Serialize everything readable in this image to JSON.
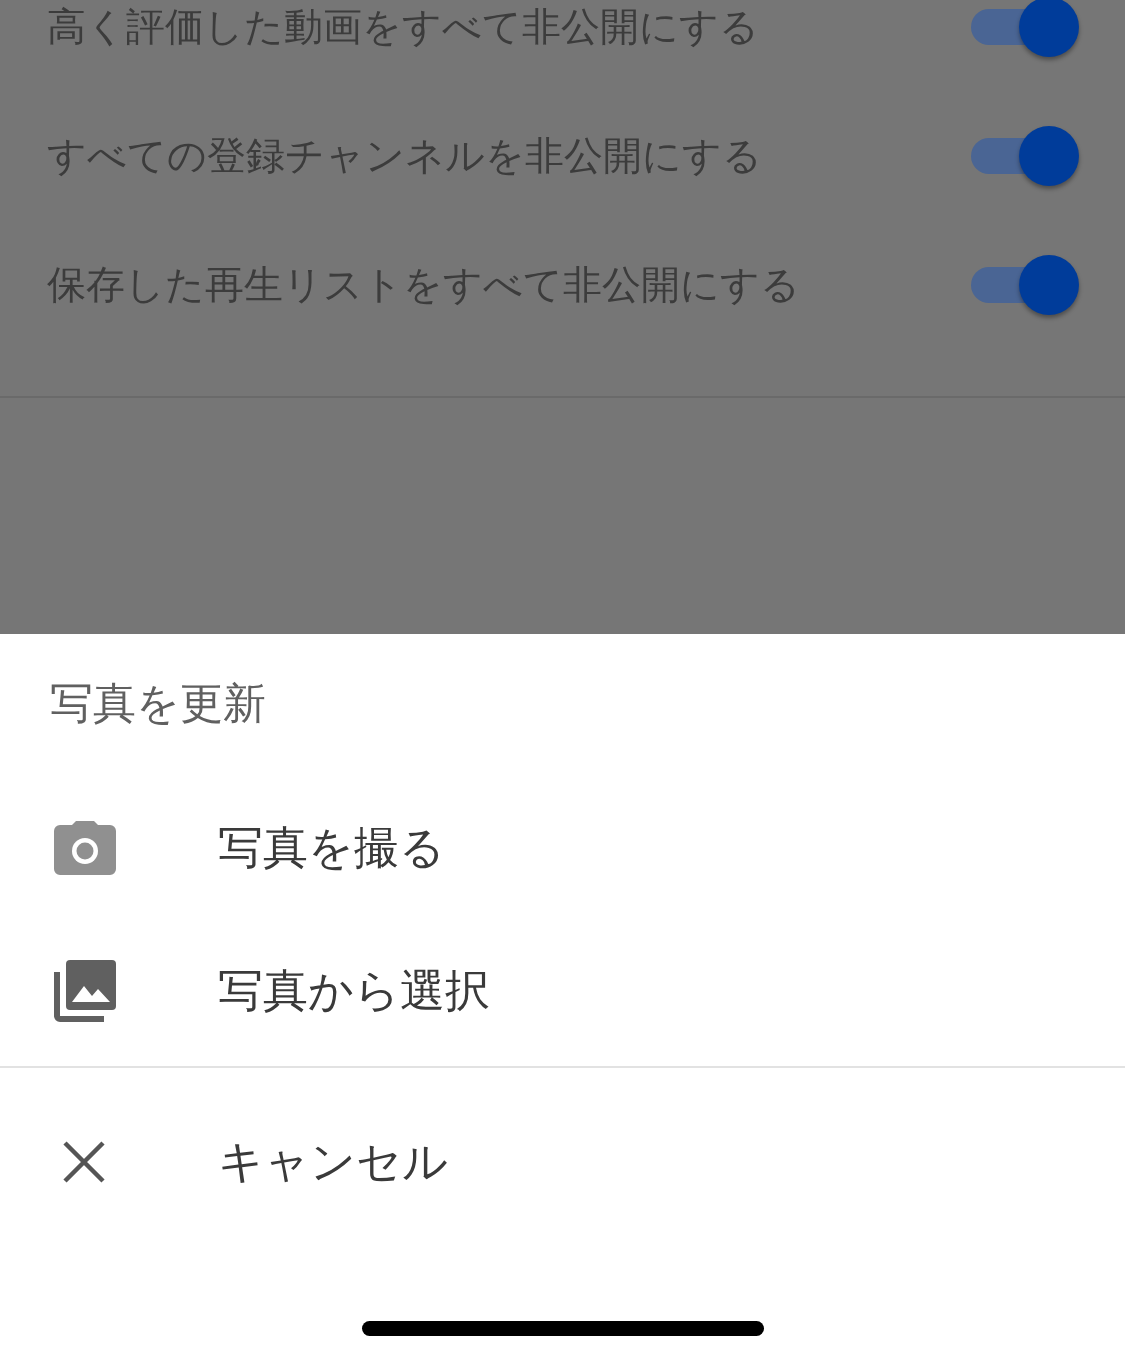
{
  "settings": [
    {
      "label": "高く評価した動画をすべて非公開にする",
      "on": true
    },
    {
      "label": "すべての登録チャンネルを非公開にする",
      "on": true
    },
    {
      "label": "保存した再生リストをすべて非公開にする",
      "on": true
    }
  ],
  "sheet": {
    "title": "写真を更新",
    "items": [
      {
        "kind": "camera",
        "label": "写真を撮る"
      },
      {
        "kind": "gallery",
        "label": "写真から選択"
      }
    ],
    "cancel": {
      "kind": "close",
      "label": "キャンセル"
    }
  }
}
